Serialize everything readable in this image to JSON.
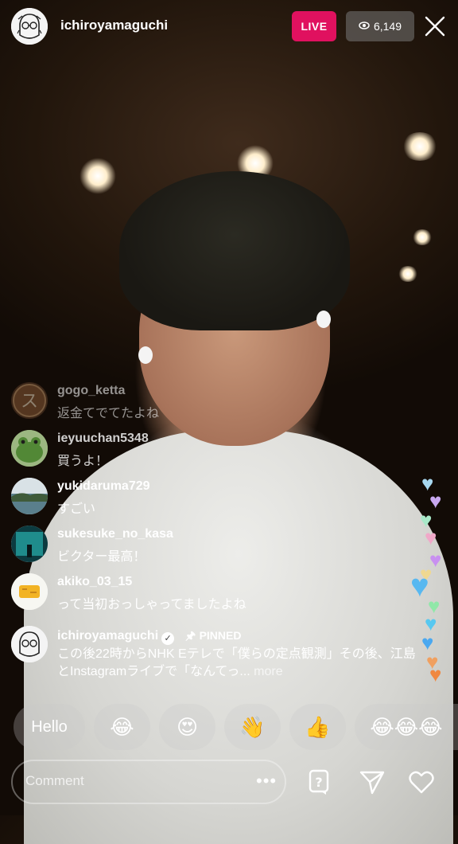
{
  "header": {
    "username": "ichiroyamaguchi",
    "live_label": "LIVE",
    "viewer_count": "6,149",
    "avatar_icon": "sketch-portrait-avatar",
    "close_icon": "close-icon"
  },
  "comments": [
    {
      "user": "gogo_ketta",
      "text": "返金てでてたよね",
      "avatar": "kanji-avatar"
    },
    {
      "user": "ieyuuchan5348",
      "text": "買うよ！",
      "avatar": "frog-avatar"
    },
    {
      "user": "yukidaruma729",
      "text": "すごい",
      "avatar": "landscape-avatar"
    },
    {
      "user": "sukesuke_no_kasa",
      "text": "ビクター最高！",
      "avatar": "aquarium-avatar"
    },
    {
      "user": "akiko_03_15",
      "text": "って当初おっしゃってましたよね",
      "avatar": "food-avatar"
    }
  ],
  "pinned": {
    "user": "ichiroyamaguchi",
    "verified": "✓",
    "pinned_label": "PINNED",
    "text": "この後22時からNHK Eテレで「僕らの定点観測」その後、江島とInstagramライブで「なんてっ...",
    "more": "more"
  },
  "quick_reactions": [
    "Hello",
    "😂",
    "😍",
    "👋",
    "👍",
    "😂😂😂"
  ],
  "bottom_bar": {
    "comment_placeholder": "Comment",
    "more_dots": "•••",
    "icons": [
      "question-box-icon",
      "send-icon",
      "heart-icon"
    ]
  },
  "colors": {
    "live_badge": "#e0115f",
    "viewer_badge": "#787878"
  }
}
